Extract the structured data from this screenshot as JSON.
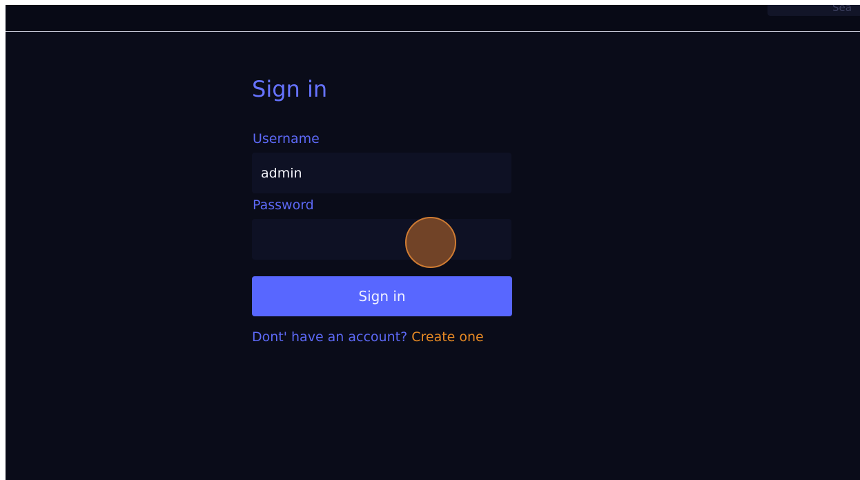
{
  "header": {
    "search_text": "Sea"
  },
  "signin": {
    "title": "Sign in",
    "username_label": "Username",
    "username_value": "admin",
    "password_label": "Password",
    "password_value": "",
    "submit_label": "Sign in",
    "no_account_text": "Dont' have an account?",
    "create_link": "Create one"
  },
  "colors": {
    "background": "#0a0c19",
    "accent": "#5867ff",
    "label": "#5d69f6",
    "link": "#e88a24"
  }
}
